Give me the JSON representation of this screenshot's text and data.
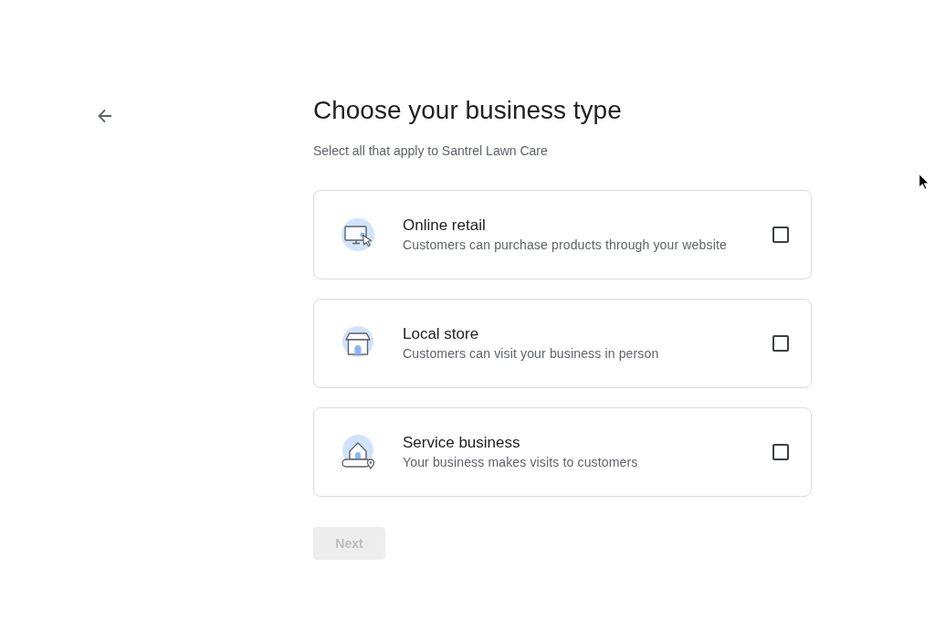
{
  "title": "Choose your business type",
  "subtitle": "Select all that apply to Santrel Lawn Care",
  "options": [
    {
      "kind": "online",
      "title": "Online retail",
      "description": "Customers can purchase products through your website",
      "checked": false
    },
    {
      "kind": "store",
      "title": "Local store",
      "description": "Customers can visit your business in person",
      "checked": false
    },
    {
      "kind": "service",
      "title": "Service business",
      "description": "Your business makes visits to customers",
      "checked": false
    }
  ],
  "next_button": {
    "label": "Next",
    "disabled": true
  }
}
